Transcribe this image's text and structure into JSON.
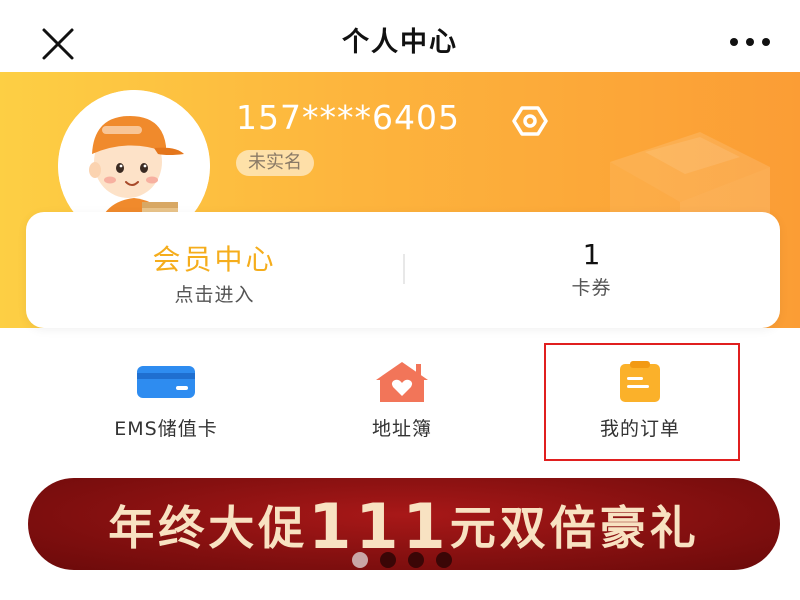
{
  "header": {
    "title": "个人中心",
    "close_icon": "close-icon",
    "more_icon": "more-horizontal-icon"
  },
  "profile": {
    "phone": "157****6405",
    "realname_status": "未实名",
    "switch_icon": "switch-account-icon"
  },
  "member_card": {
    "vip_title": "会员中心",
    "vip_sub": "点击进入",
    "coupon_count": "1",
    "coupon_label": "卡券"
  },
  "menu": [
    {
      "label": "EMS储值卡",
      "icon": "card-icon"
    },
    {
      "label": "地址簿",
      "icon": "house-heart-icon"
    },
    {
      "label": "我的订单",
      "icon": "clipboard-icon"
    }
  ],
  "banner": {
    "prefix": "年终大促",
    "number": "111",
    "suffix": "元双倍豪礼",
    "slide_count": 4,
    "active_slide": 1
  },
  "colors": {
    "hero_start": "#fdcf44",
    "hero_end": "#fb9d35",
    "vip_gold": "#f5ad1c",
    "banner_red": "#851010",
    "highlight": "#e01f1f"
  }
}
